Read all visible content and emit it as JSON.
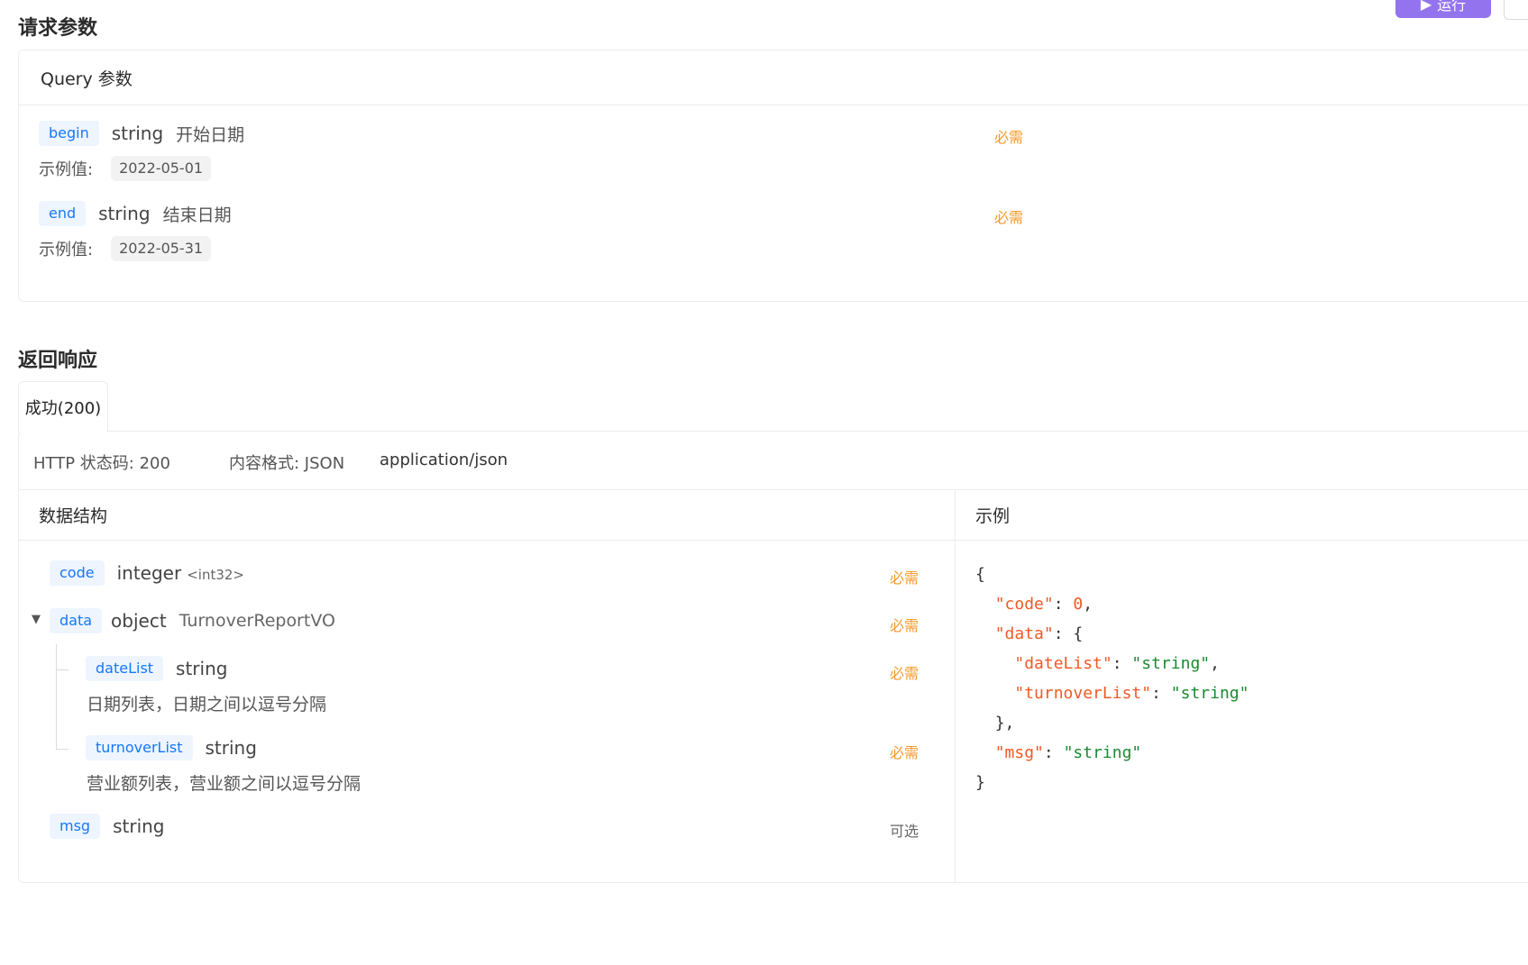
{
  "request": {
    "title": "请求参数",
    "query_header": "Query 参数",
    "params": [
      {
        "name": "begin",
        "type": "string",
        "desc": "开始日期",
        "required": "必需",
        "example_label": "示例值:",
        "example": "2022-05-01"
      },
      {
        "name": "end",
        "type": "string",
        "desc": "结束日期",
        "required": "必需",
        "example_label": "示例值:",
        "example": "2022-05-31"
      }
    ],
    "run_button": "运行"
  },
  "response": {
    "title": "返回响应",
    "tab": "成功(200)",
    "status_label": "HTTP 状态码: 200",
    "format_label": "内容格式: JSON",
    "content_type": "application/json",
    "schema_header": "数据结构",
    "example_header": "示例",
    "fields": {
      "code": {
        "name": "code",
        "type": "integer",
        "format": "<int32>",
        "required": "必需"
      },
      "data": {
        "name": "data",
        "type": "object",
        "ref": "TurnoverReportVO",
        "required": "必需"
      },
      "dateList": {
        "name": "dateList",
        "type": "string",
        "required": "必需",
        "desc": "日期列表，日期之间以逗号分隔"
      },
      "turnoverList": {
        "name": "turnoverList",
        "type": "string",
        "required": "必需",
        "desc": "营业额列表，营业额之间以逗号分隔"
      },
      "msg": {
        "name": "msg",
        "type": "string",
        "required": "可选"
      }
    },
    "example_json": {
      "l1": "{",
      "code_key": "\"code\"",
      "code_val": "0",
      "data_key": "\"data\"",
      "dateList_key": "\"dateList\"",
      "dateList_val": "\"string\"",
      "turnoverList_key": "\"turnoverList\"",
      "turnoverList_val": "\"string\"",
      "close_inner": "},",
      "msg_key": "\"msg\"",
      "msg_val": "\"string\"",
      "l_end": "}"
    }
  },
  "colors": {
    "accent": "#9373ee",
    "tag_text": "#1677ff",
    "required": "#f59a23",
    "json_key": "#ef5a26",
    "json_string": "#1a8a2f"
  }
}
